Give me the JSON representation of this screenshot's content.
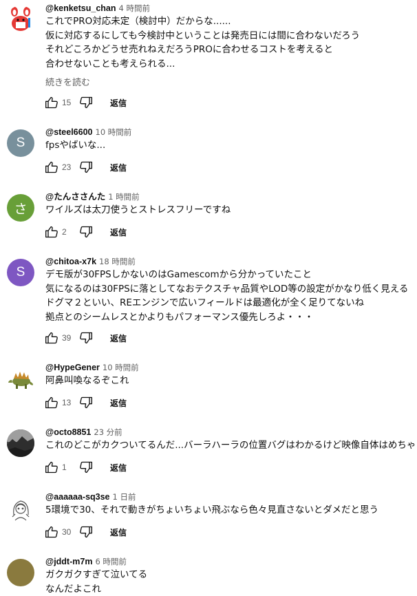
{
  "comments": [
    {
      "author": "@kenketsu_chan",
      "time": "4 時間前",
      "lines": [
        "これでPRO対応未定（検討中）だからな......",
        "仮に対応するにしても今検討中ということは発売日には間に合わないだろう",
        "それどころかどうせ売れねえだろうPROに合わせるコストを考えると",
        "合わせないことも考えられる..."
      ],
      "read_more": "続きを読む",
      "likes": "15",
      "reply": "返信",
      "avatar": {
        "type": "cartoon",
        "icon": "mascot-avatar-icon"
      }
    },
    {
      "author": "@steel6600",
      "time": "10 時間前",
      "lines": [
        "fpsやばいな..."
      ],
      "likes": "23",
      "reply": "返信",
      "avatar": {
        "type": "letter",
        "letter": "S",
        "color": "#78909c"
      }
    },
    {
      "author": "@たんささんた",
      "time": "1 時間前",
      "lines": [
        "ワイルズは太刀使うとストレスフリーですね"
      ],
      "likes": "2",
      "reply": "返信",
      "avatar": {
        "type": "letter",
        "letter": "さ",
        "color": "#689f38"
      }
    },
    {
      "author": "@chitoa-x7k",
      "time": "18 時間前",
      "lines": [
        "デモ版が30FPSしかないのはGamescomから分かっていたこと",
        "気になるのは30FPSに落としてなおテクスチャ品質やLOD等の設定がかなり低く見える",
        "ドグマ２といい、REエンジンで広いフィールドは最適化が全く足りてないね",
        "拠点とのシームレスとかよりもパフォーマンス優先しろよ・・・"
      ],
      "likes": "39",
      "reply": "返信",
      "avatar": {
        "type": "letter",
        "letter": "S",
        "color": "#7e57c2"
      }
    },
    {
      "author": "@HypeGener",
      "time": "10 時間前",
      "lines": [
        "阿鼻叫喚なるぞこれ"
      ],
      "likes": "13",
      "reply": "返信",
      "avatar": {
        "type": "photo",
        "icon": "dinosaur-avatar-icon"
      }
    },
    {
      "author": "@octo8851",
      "time": "23 分前",
      "lines": [
        "これのどこがカクついてるんだ...バーラハーラの位置バグはわかるけど映像自体はめちゃ"
      ],
      "likes": "1",
      "reply": "返信",
      "avatar": {
        "type": "photo",
        "icon": "landscape-avatar-icon"
      }
    },
    {
      "author": "@aaaaaa-sq3se",
      "time": "1 日前",
      "lines": [
        "5環境で30、それで動きがちょいちょい飛ぶなら色々見直さないとダメだと思う"
      ],
      "likes": "30",
      "reply": "返信",
      "avatar": {
        "type": "sketch",
        "icon": "anime-girl-avatar-icon"
      }
    },
    {
      "author": "@jddt-m7m",
      "time": "6 時間前",
      "lines": [
        "ガクガクすぎて泣いてる",
        "なんだよこれ"
      ],
      "likes": "",
      "reply": "",
      "avatar": {
        "type": "letter",
        "letter": "",
        "color": "#8a7a3e"
      }
    }
  ],
  "icons": {
    "like": "thumbs-up-icon",
    "dislike": "thumbs-down-icon"
  }
}
